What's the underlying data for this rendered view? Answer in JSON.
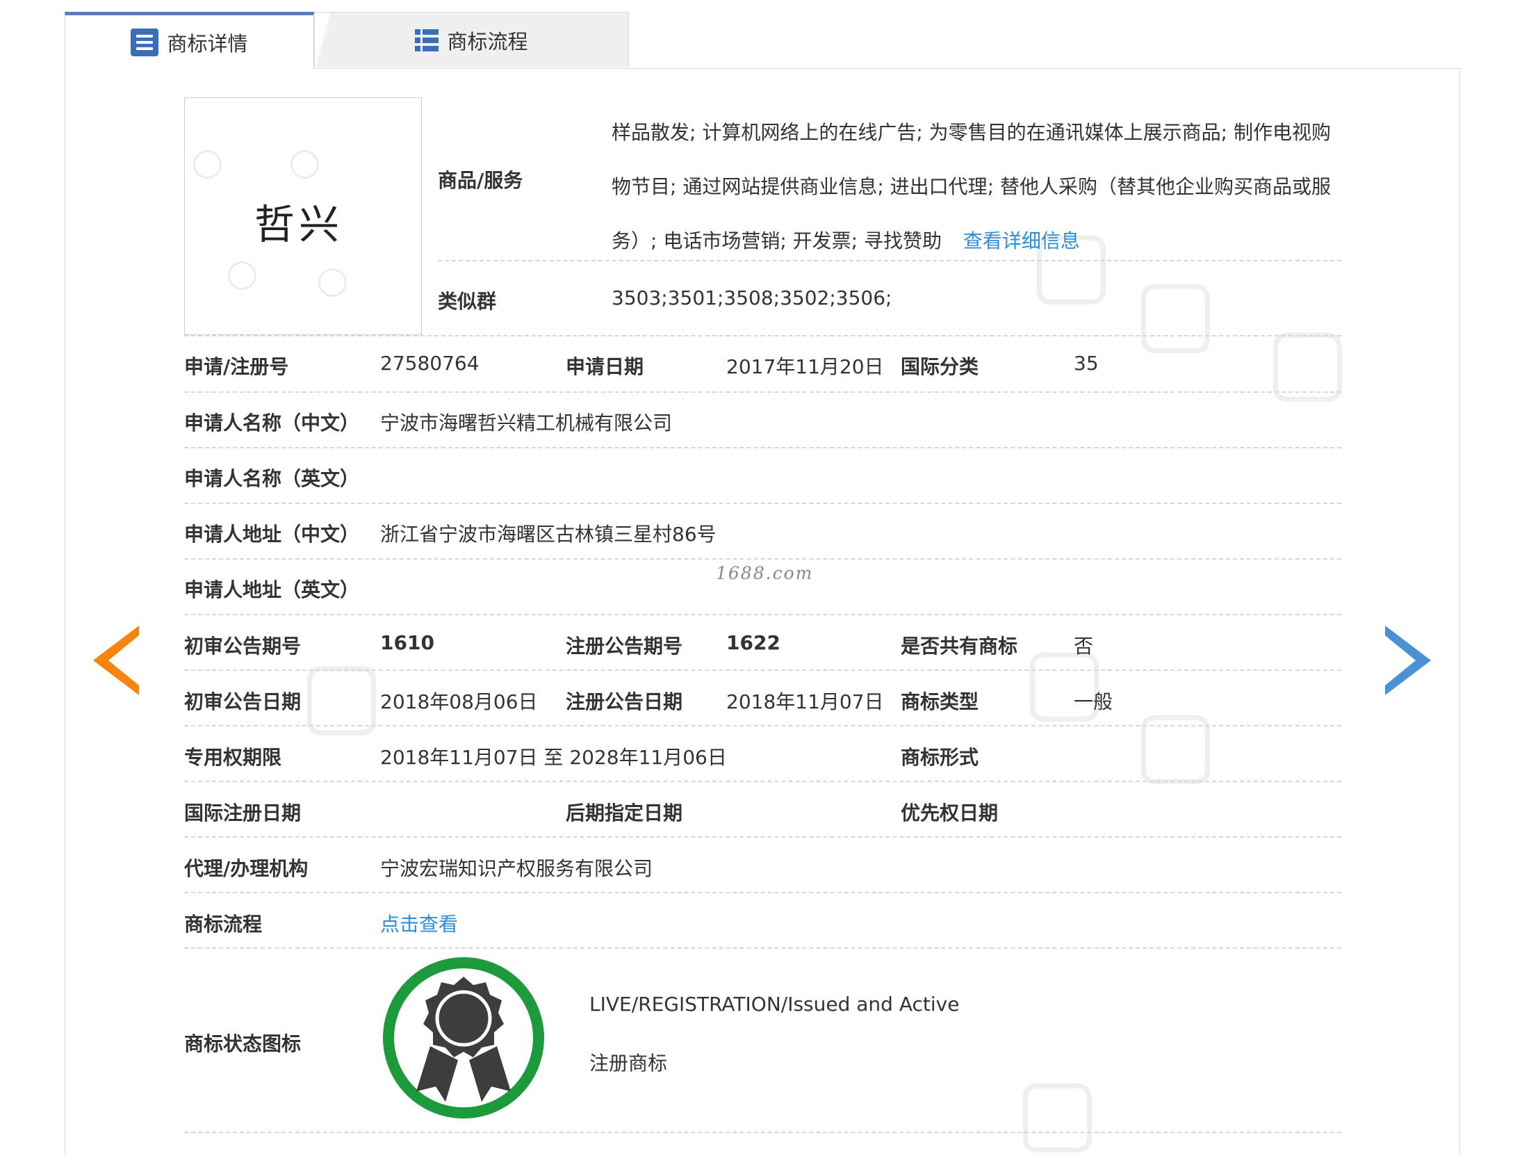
{
  "tabs": [
    {
      "label": "商标详情",
      "icon": "document-list-icon",
      "active": true
    },
    {
      "label": "商标流程",
      "icon": "list-icon",
      "active": false
    }
  ],
  "trademark": {
    "mark_text": "哲兴"
  },
  "goods": {
    "label": "商品/服务",
    "text": "样品散发; 计算机网络上的在线广告; 为零售目的在通讯媒体上展示商品; 制作电视购物节目; 通过网站提供商业信息; 进出口代理; 替他人采购（替其他企业购买商品或服务）; 电话市场营销; 开发票; 寻找赞助",
    "link": "查看详细信息"
  },
  "similar_group": {
    "label": "类似群",
    "value": "3503;3501;3508;3502;3506;"
  },
  "fields": {
    "reg_no_label": "申请/注册号",
    "reg_no": "27580764",
    "apply_date_label": "申请日期",
    "apply_date": "2017年11月20日",
    "intl_class_label": "国际分类",
    "intl_class": "35",
    "applicant_cn_label": "申请人名称（中文）",
    "applicant_cn": "宁波市海曙哲兴精工机械有限公司",
    "applicant_en_label": "申请人名称（英文）",
    "applicant_en": "",
    "address_cn_label": "申请人地址（中文）",
    "address_cn": "浙江省宁波市海曙区古林镇三星村86号",
    "address_en_label": "申请人地址（英文）",
    "address_en": "",
    "prelim_issue_label": "初审公告期号",
    "prelim_issue": "1610",
    "reg_issue_label": "注册公告期号",
    "reg_issue": "1622",
    "shared_label": "是否共有商标",
    "shared": "否",
    "prelim_date_label": "初审公告日期",
    "prelim_date": "2018年08月06日",
    "reg_date_label": "注册公告日期",
    "reg_date": "2018年11月07日",
    "tm_type_label": "商标类型",
    "tm_type": "一般",
    "exclusive_label": "专用权期限",
    "exclusive": "2018年11月07日 至 2028年11月06日",
    "tm_form_label": "商标形式",
    "tm_form": "",
    "intl_reg_date_label": "国际注册日期",
    "intl_reg_date": "",
    "later_date_label": "后期指定日期",
    "later_date": "",
    "priority_date_label": "优先权日期",
    "priority_date": "",
    "agent_label": "代理/办理机构",
    "agent": "宁波宏瑞知识产权服务有限公司",
    "flow_label": "商标流程",
    "flow_link": "点击查看",
    "status_label": "商标状态图标",
    "status_en": "LIVE/REGISTRATION/Issued and Active",
    "status_cn": "注册商标"
  },
  "watermark_site": "1688.com",
  "colors": {
    "accent_blue": "#3a6fb8",
    "link": "#2f8ed6",
    "prev_arrow": "#f5850f",
    "next_arrow": "#4a90d6",
    "badge_ring": "#1d9a3c",
    "badge_medal": "#3d3d3d"
  }
}
